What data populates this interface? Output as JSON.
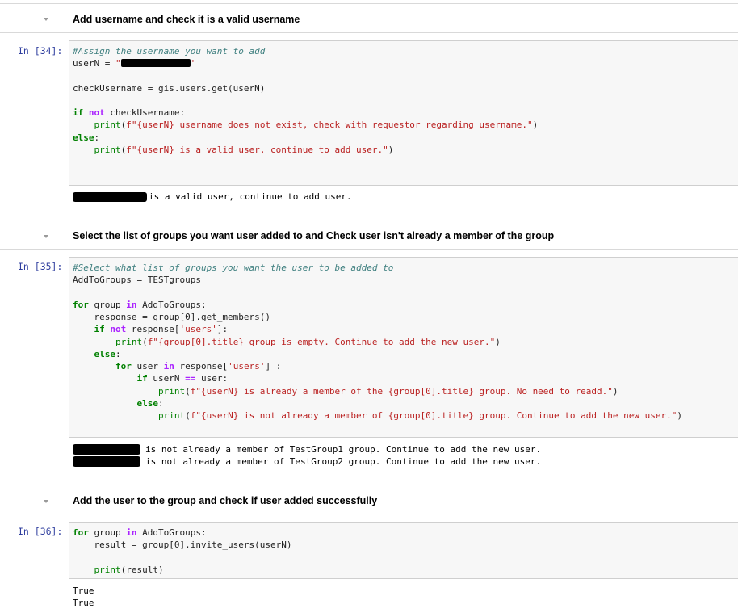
{
  "cells": {
    "md1": {
      "heading": "Add username and check it is a valid username"
    },
    "code34": {
      "prompt": "In [34]:",
      "comment": "#Assign the username you want to add",
      "line_user_var": "userN",
      "line_user_eq": " = ",
      "line_user_q1": "\"",
      "line_user_q2": "'",
      "check_var": "checkUsername",
      "check_eq": " = ",
      "check_call": "gis.users.get(userN)",
      "if_kw": "if",
      "if_not": " not",
      "if_rest": " checkUsername:",
      "print1_fn": "    print(",
      "print1_str": "f\"{userN} username does not exist, check with requestor regarding username.\"",
      "print1_end": ")",
      "else_kw": "else",
      "else_colon": ":",
      "print2_fn": "    print(",
      "print2_str": "f\"{userN} is a valid user, continue to add user.\"",
      "print2_end": ")",
      "output": "is a valid user, continue to add user."
    },
    "md2": {
      "heading": "Select the list of groups you want user added to and Check user isn't already a member of the group"
    },
    "code35": {
      "prompt": "In [35]:",
      "comment": "#Select what list of groups you want the user to be added to",
      "line1": "AddToGroups = TESTgroups",
      "for_kw": "for",
      "for_mid": " group ",
      "for_in": "in",
      "for_rest": " AddToGroups:",
      "resp_line": "    response = group[0].get_members()",
      "if_pre": "    ",
      "if_kw": "if",
      "if_not": " not",
      "if_rest": " response[",
      "if_str": "'users'",
      "if_end": "]:",
      "print_empty_fn": "        print(",
      "print_empty_str": "f\"{group[0].title} group is empty. Continue to add the new user.\"",
      "print_empty_end": ")",
      "else_pre": "    ",
      "else_kw": "else",
      "else_colon": ":",
      "for2_pre": "        ",
      "for2_kw": "for",
      "for2_mid": " user ",
      "for2_in": "in",
      "for2_rest": " response[",
      "for2_str": "'users'",
      "for2_end": "] :",
      "if2_pre": "            ",
      "if2_kw": "if",
      "if2_mid": " userN ",
      "if2_op": "==",
      "if2_rest": " user:",
      "print_already_fn": "                print(",
      "print_already_str": "f\"{userN} is already a member of the {group[0].title} group. No need to readd.\"",
      "print_already_end": ")",
      "else2_pre": "            ",
      "else2_kw": "else",
      "else2_colon": ":",
      "print_notmember_fn": "                print(",
      "print_notmember_str": "f\"{userN} is not already a member of {group[0].title} group. Continue to add the new user.\"",
      "print_notmember_end": ")",
      "output1": "is not already a member of TestGroup1 group. Continue to add the new user.",
      "output2": "is not already a member of TestGroup2 group. Continue to add the new user."
    },
    "md3": {
      "heading": "Add the user to the group and check if user added successfully"
    },
    "code36": {
      "prompt": "In [36]:",
      "for_kw": "for",
      "for_mid": " group ",
      "for_in": "in",
      "for_rest": " AddToGroups:",
      "result_line": "    result = group[0].invite_users(userN)",
      "print_fn": "    print(result)",
      "output1": "True",
      "output2": "True"
    }
  },
  "icons": {
    "collapse": "chevron-down-icon"
  },
  "colors": {
    "prompt": "#303f9f",
    "keyword": "#008000",
    "comment": "#408080",
    "string": "#ba2121",
    "cell_bg": "#f7f7f7",
    "cell_border": "#cfcfcf"
  }
}
